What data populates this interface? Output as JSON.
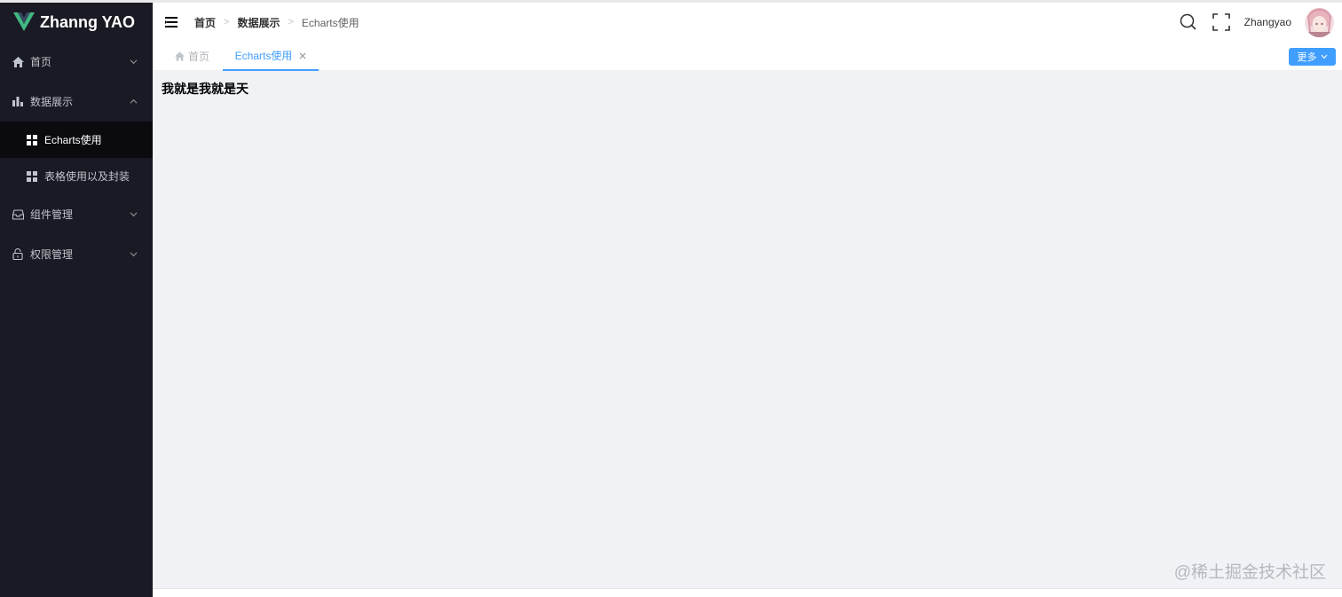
{
  "logo": {
    "text": "Zhanng YAO"
  },
  "sidebar": {
    "items": [
      {
        "label": "首页",
        "icon": "home-icon",
        "expanded": false
      },
      {
        "label": "数据展示",
        "icon": "bar-chart-icon",
        "expanded": true,
        "children": [
          {
            "label": "Echarts使用",
            "icon": "grid-icon",
            "active": true
          },
          {
            "label": "表格使用以及封装",
            "icon": "grid-icon",
            "active": false
          }
        ]
      },
      {
        "label": "组件管理",
        "icon": "inbox-icon",
        "expanded": false
      },
      {
        "label": "权限管理",
        "icon": "lock-icon",
        "expanded": false
      }
    ]
  },
  "header": {
    "breadcrumb": [
      "首页",
      "数据展示",
      "Echarts使用"
    ],
    "username": "Zhangyao"
  },
  "tags": {
    "home": "首页",
    "active": "Echarts使用",
    "more": "更多"
  },
  "main": {
    "text": "我就是我就是天"
  },
  "watermark": "@稀土掘金技术社区",
  "colors": {
    "sidebar_bg": "#191a23",
    "accent": "#409eff",
    "main_bg": "#f0f2f5",
    "logo_green": "#41b883"
  }
}
